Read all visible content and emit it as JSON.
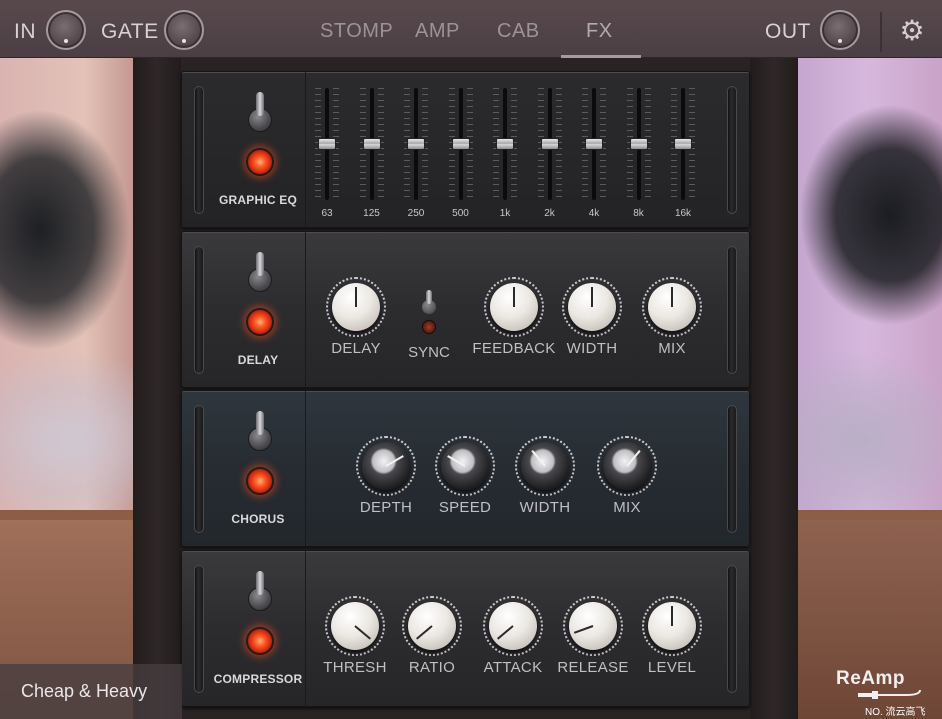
{
  "topbar": {
    "in_label": "IN",
    "gate_label": "GATE",
    "out_label": "OUT",
    "tabs": [
      {
        "label": "STOMP",
        "active": false
      },
      {
        "label": "AMP",
        "active": false
      },
      {
        "label": "CAB",
        "active": false
      },
      {
        "label": "FX",
        "active": true
      }
    ],
    "settings_icon": "gear-icon"
  },
  "units": {
    "eq": {
      "name": "GRAPHIC EQ",
      "bands": [
        {
          "freq": "63",
          "level": 0.5
        },
        {
          "freq": "125",
          "level": 0.5
        },
        {
          "freq": "250",
          "level": 0.5
        },
        {
          "freq": "500",
          "level": 0.5
        },
        {
          "freq": "1k",
          "level": 0.5
        },
        {
          "freq": "2k",
          "level": 0.5
        },
        {
          "freq": "4k",
          "level": 0.5
        },
        {
          "freq": "8k",
          "level": 0.5
        },
        {
          "freq": "16k",
          "level": 0.5
        }
      ]
    },
    "delay": {
      "name": "DELAY",
      "knobs": [
        {
          "label": "DELAY",
          "angle": 0
        },
        {
          "label": "FEEDBACK",
          "angle": 0
        },
        {
          "label": "WIDTH",
          "angle": 0
        },
        {
          "label": "MIX",
          "angle": 0
        }
      ],
      "sync_label": "SYNC"
    },
    "chorus": {
      "name": "CHORUS",
      "knobs": [
        {
          "label": "DEPTH",
          "angle": 60
        },
        {
          "label": "SPEED",
          "angle": -60
        },
        {
          "label": "WIDTH",
          "angle": -40
        },
        {
          "label": "MIX",
          "angle": 40
        }
      ]
    },
    "compressor": {
      "name": "COMPRESSOR",
      "knobs": [
        {
          "label": "THRESH",
          "angle": 130
        },
        {
          "label": "RATIO",
          "angle": -130
        },
        {
          "label": "ATTACK",
          "angle": -130
        },
        {
          "label": "RELEASE",
          "angle": -110
        },
        {
          "label": "LEVEL",
          "angle": 0
        }
      ]
    }
  },
  "footer": {
    "preset_name": "Cheap & Heavy",
    "logo": "ReAmp",
    "watermark": "NO. 流云高飞"
  }
}
